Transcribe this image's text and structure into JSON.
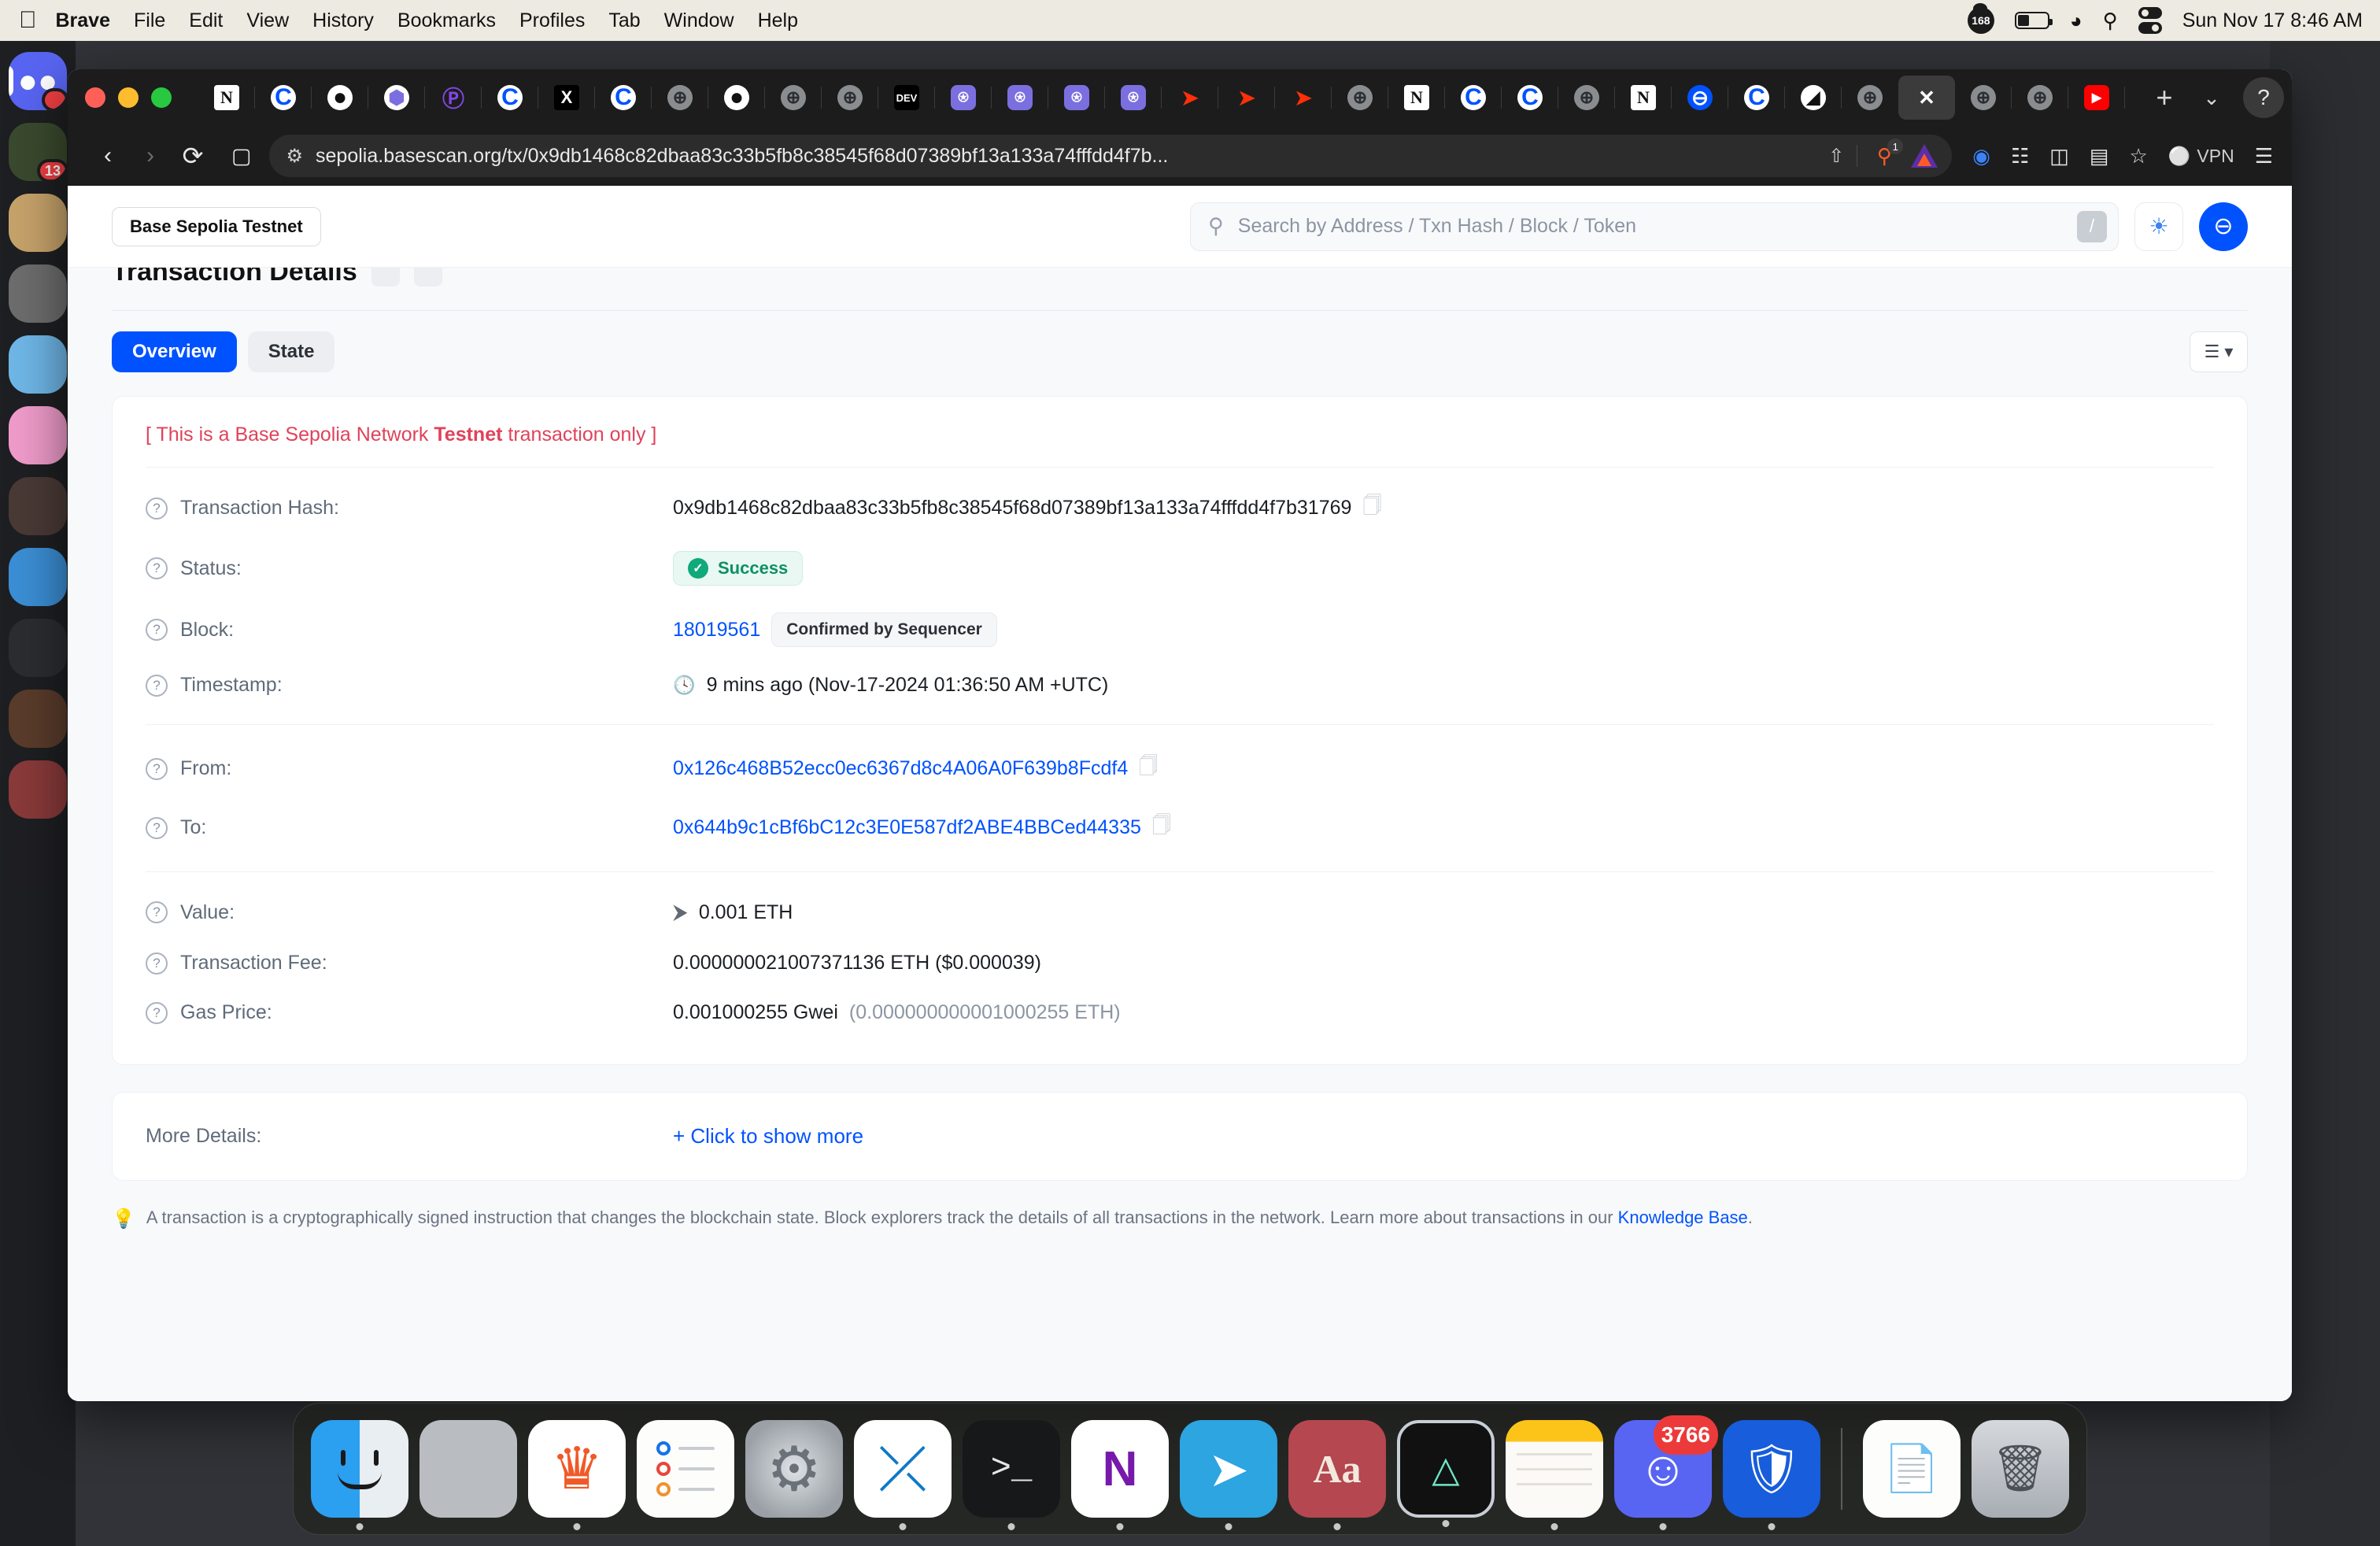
{
  "menubar": {
    "apple": "&#63743;",
    "items": [
      "Brave",
      "File",
      "Edit",
      "View",
      "History",
      "Bookmarks",
      "Profiles",
      "Tab",
      "Window",
      "Help"
    ],
    "badge_count": "168",
    "clock": "Sun Nov 17  8:46 AM"
  },
  "browser": {
    "url": "sepolia.basescan.org/tx/0x9db1468c82dbaa83c33b5fb8c38545f68d07389bf13a133a74fffdd4f7b...",
    "shield_count": "1",
    "vpn_label": "VPN",
    "tabs": [
      {
        "name": "notion",
        "glyph": "N"
      },
      {
        "name": "coinbase",
        "glyph": "C"
      },
      {
        "name": "github",
        "glyph": "●"
      },
      {
        "name": "ethereum",
        "glyph": "⬢"
      },
      {
        "name": "polygon",
        "glyph": "Ⓟ"
      },
      {
        "name": "coinbase",
        "glyph": "C"
      },
      {
        "name": "x",
        "glyph": "X"
      },
      {
        "name": "coinbase",
        "glyph": "C"
      },
      {
        "name": "globe",
        "glyph": "⊕"
      },
      {
        "name": "github",
        "glyph": "●"
      },
      {
        "name": "globe",
        "glyph": "⊕"
      },
      {
        "name": "globe",
        "glyph": "⊕"
      },
      {
        "name": "dev",
        "glyph": "DEV"
      },
      {
        "name": "openai",
        "glyph": "⍟"
      },
      {
        "name": "openai",
        "glyph": "⍟"
      },
      {
        "name": "openai",
        "glyph": "⍟"
      },
      {
        "name": "openai",
        "glyph": "⍟"
      },
      {
        "name": "doordash",
        "glyph": "➤"
      },
      {
        "name": "doordash",
        "glyph": "➤"
      },
      {
        "name": "doordash",
        "glyph": "➤"
      },
      {
        "name": "globe",
        "glyph": "⊕"
      },
      {
        "name": "notion",
        "glyph": "N"
      },
      {
        "name": "coinbase",
        "glyph": "C"
      },
      {
        "name": "coinbase",
        "glyph": "C"
      },
      {
        "name": "globe",
        "glyph": "⊕"
      },
      {
        "name": "notion",
        "glyph": "N"
      },
      {
        "name": "base",
        "glyph": "⊖"
      },
      {
        "name": "coinbase",
        "glyph": "C"
      },
      {
        "name": "chart",
        "glyph": "◢"
      },
      {
        "name": "globe",
        "glyph": "⊕"
      },
      {
        "name": "basescan",
        "glyph": "✕",
        "active": true
      },
      {
        "name": "globe",
        "glyph": "⊕"
      },
      {
        "name": "globe",
        "glyph": "⊕"
      },
      {
        "name": "youtube",
        "glyph": "▶"
      },
      {
        "name": "youtube",
        "glyph": "▶"
      }
    ],
    "new_tab": "+",
    "tab_list_chevron": "⌄",
    "help": "?"
  },
  "site": {
    "network_badge": "Base Sepolia Testnet",
    "search": {
      "placeholder": "Search by Address / Txn Hash / Block / Token",
      "shortcut": "/",
      "icon": "⚲"
    },
    "theme_icon": "☀",
    "logo_icon": "⊖"
  },
  "page": {
    "title": "Transaction Details",
    "tabs": [
      {
        "label": "Overview",
        "active": true
      },
      {
        "label": "State",
        "active": false
      }
    ],
    "testnet_note_prefix": "[ This is a Base Sepolia Network ",
    "testnet_note_bold": "Testnet",
    "testnet_note_suffix": " transaction only ]",
    "rows": {
      "tx_hash_label": "Transaction Hash:",
      "tx_hash_value": "0x9db1468c82dbaa83c33b5fb8c38545f68d07389bf13a133a74fffdd4f7b31769",
      "status_label": "Status:",
      "status_value": "Success",
      "block_label": "Block:",
      "block_value": "18019561",
      "block_badge": "Confirmed by Sequencer",
      "timestamp_label": "Timestamp:",
      "timestamp_value": "9 mins ago (Nov-17-2024 01:36:50 AM +UTC)",
      "from_label": "From:",
      "from_value": "0x126c468B52ecc0ec6367d8c4A06A0F639b8Fcdf4",
      "to_label": "To:",
      "to_value": "0x644b9c1cBf6bC12c3E0E587df2ABE4BBCed44335",
      "value_label": "Value:",
      "value_value": "0.001 ETH",
      "fee_label": "Transaction Fee:",
      "fee_value": "0.000000021007371136 ETH ($0.000039)",
      "gas_label": "Gas Price:",
      "gas_value": "0.001000255 Gwei",
      "gas_value_eth": "(0.000000000001000255 ETH)"
    },
    "more_details_label": "More Details:",
    "more_details_link": "+ Click to show more",
    "footer_text": "A transaction is a cryptographically signed instruction that changes the blockchain state. Block explorers track the details of all transactions in the network. Learn more about transactions in our ",
    "footer_link": "Knowledge Base",
    "footer_period": "."
  },
  "discord": {
    "badge_main": "",
    "badge_second": "13"
  },
  "dock": {
    "items": [
      {
        "name": "finder",
        "label": "Finder"
      },
      {
        "name": "launchpad",
        "label": "Launchpad"
      },
      {
        "name": "brave",
        "label": "Brave Browser"
      },
      {
        "name": "reminders",
        "label": "Reminders"
      },
      {
        "name": "system-settings",
        "label": "System Settings"
      },
      {
        "name": "vscode",
        "label": "Visual Studio Code"
      },
      {
        "name": "terminal",
        "label": "Terminal"
      },
      {
        "name": "onenote",
        "label": "OneNote"
      },
      {
        "name": "telegram",
        "label": "Telegram"
      },
      {
        "name": "dictionary",
        "label": "Dictionary"
      },
      {
        "name": "activity-monitor",
        "label": "Activity Monitor"
      },
      {
        "name": "notes",
        "label": "Notes"
      },
      {
        "name": "discord",
        "label": "Discord",
        "badge": "3766"
      },
      {
        "name": "bitwarden",
        "label": "Bitwarden"
      },
      {
        "name": "document",
        "label": "Document"
      },
      {
        "name": "trash",
        "label": "Trash"
      }
    ]
  }
}
